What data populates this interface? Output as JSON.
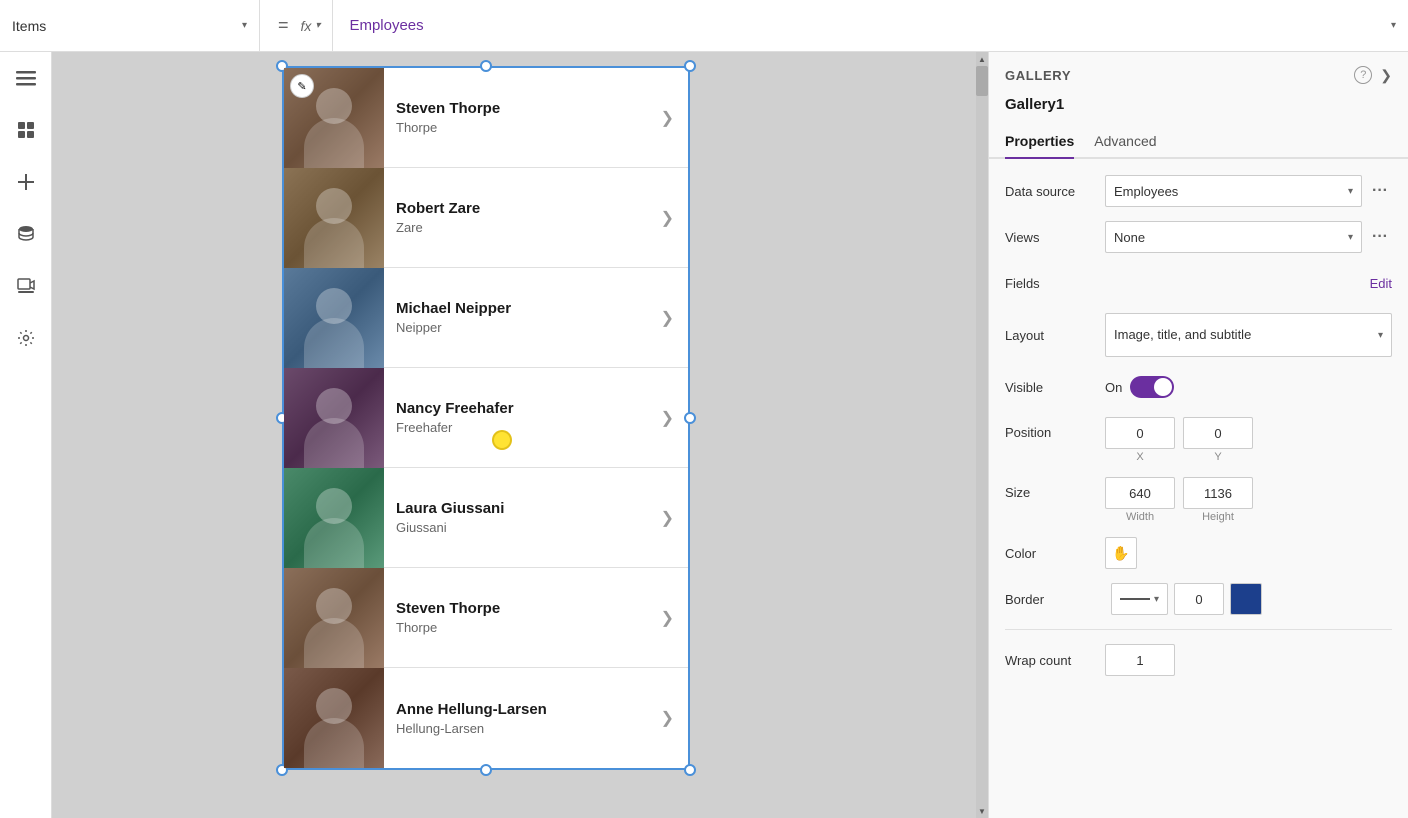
{
  "topbar": {
    "items_label": "Items",
    "items_arrow": "▾",
    "fx_label": "fx",
    "fx_arrow": "▾",
    "equals": "=",
    "formula": "Employees",
    "formula_arrow": "▾"
  },
  "sidebar": {
    "icons": [
      {
        "name": "hamburger-icon",
        "symbol": "☰"
      },
      {
        "name": "layers-icon",
        "symbol": "⊞"
      },
      {
        "name": "add-icon",
        "symbol": "+"
      },
      {
        "name": "database-icon",
        "symbol": "⬡"
      },
      {
        "name": "media-icon",
        "symbol": "▶"
      },
      {
        "name": "tools-icon",
        "symbol": "⚙"
      }
    ]
  },
  "gallery": {
    "edit_icon": "✎",
    "items": [
      {
        "id": 1,
        "name": "Steven Thorpe",
        "subtitle": "Thorpe",
        "photo_class": "photo-1"
      },
      {
        "id": 2,
        "name": "Robert Zare",
        "subtitle": "Zare",
        "photo_class": "photo-2"
      },
      {
        "id": 3,
        "name": "Michael Neipper",
        "subtitle": "Neipper",
        "photo_class": "photo-3"
      },
      {
        "id": 4,
        "name": "Nancy Freehafer",
        "subtitle": "Freehafer",
        "photo_class": "photo-4"
      },
      {
        "id": 5,
        "name": "Laura Giussani",
        "subtitle": "Giussani",
        "photo_class": "photo-5"
      },
      {
        "id": 6,
        "name": "Steven Thorpe",
        "subtitle": "Thorpe",
        "photo_class": "photo-6"
      },
      {
        "id": 7,
        "name": "Anne Hellung-Larsen",
        "subtitle": "Hellung-Larsen",
        "photo_class": "photo-7"
      }
    ],
    "arrow": "❯"
  },
  "right_panel": {
    "title": "GALLERY",
    "help": "?",
    "expand": "❯",
    "gallery_name": "Gallery1",
    "tabs": [
      {
        "id": "properties",
        "label": "Properties",
        "active": true
      },
      {
        "id": "advanced",
        "label": "Advanced",
        "active": false
      }
    ],
    "data_source_label": "Data source",
    "data_source_value": "Employees",
    "views_label": "Views",
    "views_value": "None",
    "fields_label": "Fields",
    "fields_edit": "Edit",
    "layout_label": "Layout",
    "layout_value": "Image, title, and subtitle",
    "visible_label": "Visible",
    "visible_on": "On",
    "position_label": "Position",
    "pos_x": "0",
    "pos_y": "0",
    "x_label": "X",
    "y_label": "Y",
    "size_label": "Size",
    "size_w": "640",
    "size_h": "1136",
    "w_label": "Width",
    "h_label": "Height",
    "color_label": "Color",
    "color_icon": "✋",
    "border_label": "Border",
    "border_num": "0",
    "divider": "",
    "wrap_count_label": "Wrap count",
    "wrap_count_value": "1"
  }
}
